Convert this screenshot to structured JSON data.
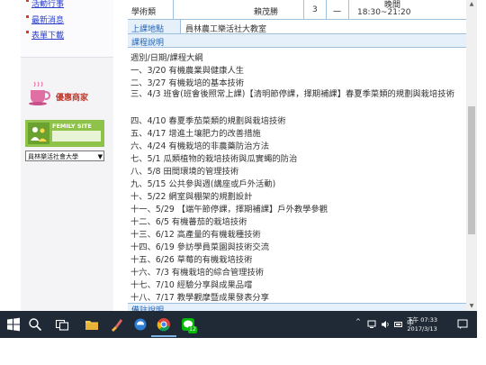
{
  "sidebar": {
    "links": [
      "活動行事",
      "最新消息",
      "表單下載"
    ],
    "promo_label": "優惠商家",
    "femily_label": "FEMILY SITE",
    "select_value": "員林樂活社會大學"
  },
  "course_table": {
    "category": "學術類",
    "teacher": "賴茂勝",
    "credits": "3",
    "dash": "一",
    "time_label": "晚間",
    "time_range": "18:30~21:20",
    "location_label": "上課地點",
    "location_value": "員林農工樂活社大教室",
    "section_title": "課程說明",
    "footer_section": "備註說明"
  },
  "syllabus": [
    "週別/日期/課程大綱",
    "一、3/20 有機農業與健康人生",
    "二、3/27 有機栽培的基本技術",
    "三、4/3 班會(班會後照常上課)【清明節停課，擇期補課】春夏季菜類的規劃與栽培技術",
    "四、4/10 春夏季茄菜類的規劃與栽培技術",
    "五、4/17 增進土壤肥力的改善措施",
    "六、4/24 有機栽培的非農藥防治方法",
    "七、5/1 瓜類植物的栽培技術與瓜實蠅的防治",
    "八、5/8 田間環境的管理技術",
    "九、5/15 公共參與週(講座或戶外活動)",
    "十、5/22 網室與棚架的規劃設計",
    "十一、5/29 【端午節停課，擇期補課】戶外教學參觀",
    "十二、6/5 有機蕃茄的栽培技術",
    "十三、6/12 高產量的有機栽種技術",
    "十四、6/19 參訪學員菜園與技術交流",
    "十五、6/26 草莓的有機栽培技術",
    "十六、7/3 有機栽培的綜合管理技術",
    "十七、7/10 經驗分享與成果品嚐",
    "十八、7/17 教學觀摩暨成果發表分享"
  ],
  "taskbar": {
    "time": "下午 07:33",
    "date": "2017/3/13",
    "notif_count": "12"
  }
}
